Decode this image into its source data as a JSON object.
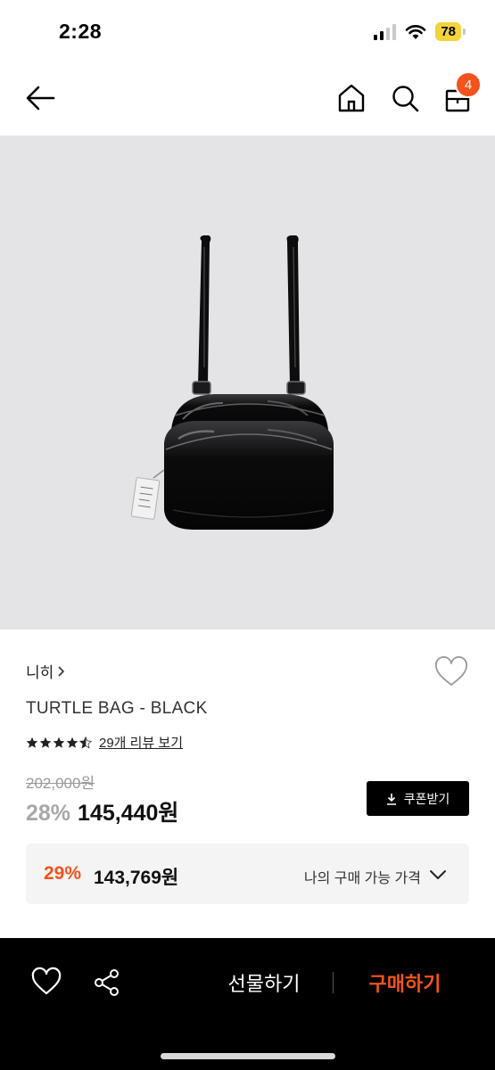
{
  "status_bar": {
    "time": "2:28",
    "battery": "78",
    "icons": [
      "cellular-signal-icon",
      "wifi-icon",
      "battery-icon"
    ]
  },
  "nav": {
    "icons": [
      "back-arrow-icon",
      "home-icon",
      "search-icon",
      "shopping-bag-icon"
    ],
    "cart_count": "4",
    "badge_color": "#f3531c"
  },
  "product": {
    "brand": "니히",
    "name": "TURTLE BAG - BLACK",
    "rating": 4.5,
    "review_link": "29개 리뷰 보기",
    "original_price": "202,000원",
    "discount_rate": "28%",
    "sale_price": "145,440원",
    "coupon_label": "쿠폰받기"
  },
  "my_price": {
    "rate": "29%",
    "price": "143,769원",
    "label": "나의 구매 가능 가격"
  },
  "bottom_bar": {
    "gift_label": "선물하기",
    "buy_label": "구매하기",
    "accent": "#f3531c"
  }
}
